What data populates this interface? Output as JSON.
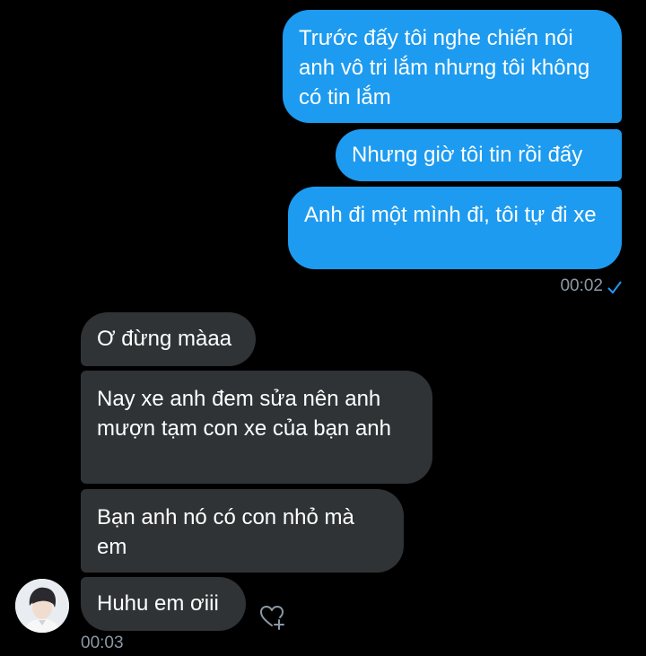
{
  "sent_messages": [
    {
      "text": "Trước đấy tôi nghe chiến nói anh vô tri lắm nhưng tôi không có tin lắm"
    },
    {
      "text": "Nhưng giờ tôi tin rồi đấy"
    },
    {
      "text": "Anh đi một mình đi, tôi tự đi xe"
    }
  ],
  "sent_time": "00:02",
  "received_messages": [
    {
      "text": "Ơ đừng màaa"
    },
    {
      "text": "Nay xe anh đem sửa nên anh mượn tạm con xe của bạn anh"
    },
    {
      "text": "Bạn anh nó có con nhỏ mà em"
    },
    {
      "text": "Huhu em ơiii"
    }
  ],
  "received_time": "00:03",
  "icons": {
    "read_receipt": "check-icon",
    "react": "heart-plus-icon",
    "avatar": "avatar"
  },
  "colors": {
    "sent_bubble": "#1d9bf0",
    "received_bubble": "#2f3336",
    "background": "#000000",
    "timestamp": "#8b98a5"
  }
}
